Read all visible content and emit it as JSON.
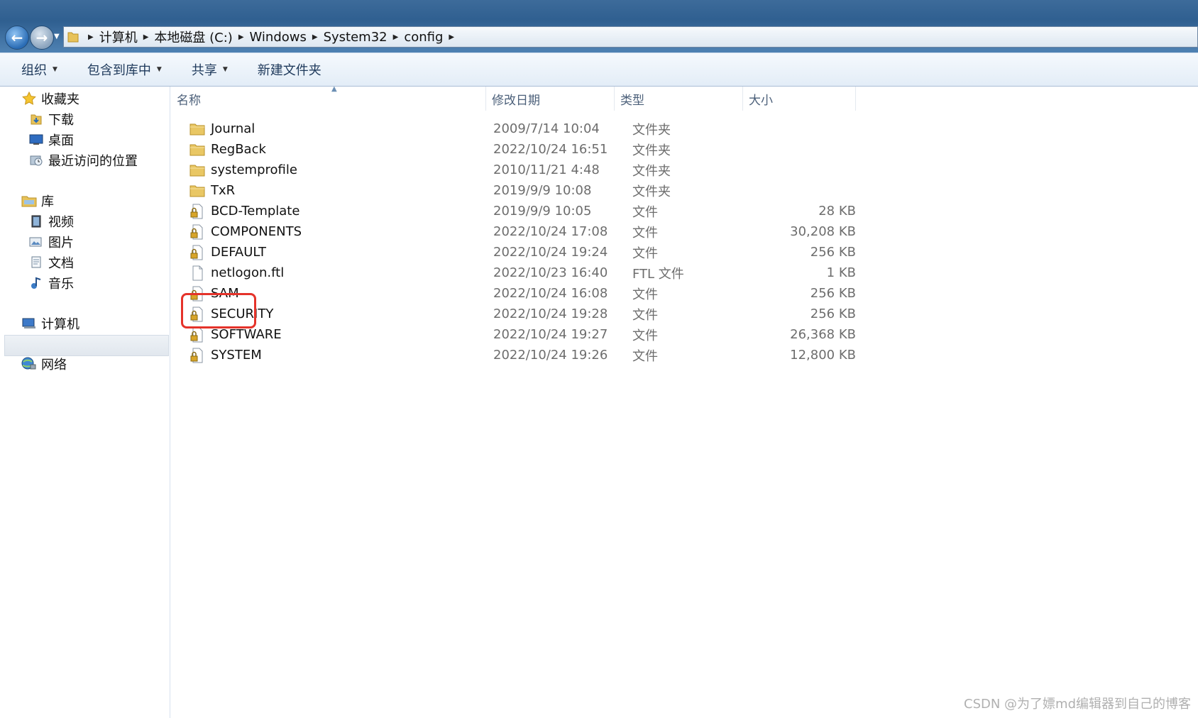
{
  "address_bar": {
    "breadcrumbs": [
      "计算机",
      "本地磁盘 (C:)",
      "Windows",
      "System32",
      "config"
    ]
  },
  "toolbar": {
    "organize": "组织",
    "include_in_library": "包含到库中",
    "share": "共享",
    "new_folder": "新建文件夹"
  },
  "nav": {
    "favorites": "收藏夹",
    "downloads": "下载",
    "desktop": "桌面",
    "recent_places": "最近访问的位置",
    "libraries": "库",
    "videos": "视频",
    "pictures": "图片",
    "documents": "文档",
    "music": "音乐",
    "computer": "计算机",
    "network": "网络"
  },
  "columns": {
    "name": "名称",
    "date_modified": "修改日期",
    "type": "类型",
    "size": "大小"
  },
  "files": [
    {
      "name": "Journal",
      "date": "2009/7/14 10:04",
      "type": "文件夹",
      "size": "",
      "kind": "folder"
    },
    {
      "name": "RegBack",
      "date": "2022/10/24 16:51",
      "type": "文件夹",
      "size": "",
      "kind": "folder"
    },
    {
      "name": "systemprofile",
      "date": "2010/11/21 4:48",
      "type": "文件夹",
      "size": "",
      "kind": "folder"
    },
    {
      "name": "TxR",
      "date": "2019/9/9 10:08",
      "type": "文件夹",
      "size": "",
      "kind": "folder"
    },
    {
      "name": "BCD-Template",
      "date": "2019/9/9 10:05",
      "type": "文件",
      "size": "28 KB",
      "kind": "locked-file"
    },
    {
      "name": "COMPONENTS",
      "date": "2022/10/24 17:08",
      "type": "文件",
      "size": "30,208 KB",
      "kind": "locked-file"
    },
    {
      "name": "DEFAULT",
      "date": "2022/10/24 19:24",
      "type": "文件",
      "size": "256 KB",
      "kind": "locked-file"
    },
    {
      "name": "netlogon.ftl",
      "date": "2022/10/23 16:40",
      "type": "FTL 文件",
      "size": "1 KB",
      "kind": "file"
    },
    {
      "name": "SAM",
      "date": "2022/10/24 16:08",
      "type": "文件",
      "size": "256 KB",
      "kind": "locked-file"
    },
    {
      "name": "SECURITY",
      "date": "2022/10/24 19:28",
      "type": "文件",
      "size": "256 KB",
      "kind": "locked-file"
    },
    {
      "name": "SOFTWARE",
      "date": "2022/10/24 19:27",
      "type": "文件",
      "size": "26,368 KB",
      "kind": "locked-file"
    },
    {
      "name": "SYSTEM",
      "date": "2022/10/24 19:26",
      "type": "文件",
      "size": "12,800 KB",
      "kind": "locked-file"
    }
  ],
  "highlight_color": "#e5332a",
  "watermark": "CSDN @为了嫖md编辑器到自己的博客"
}
